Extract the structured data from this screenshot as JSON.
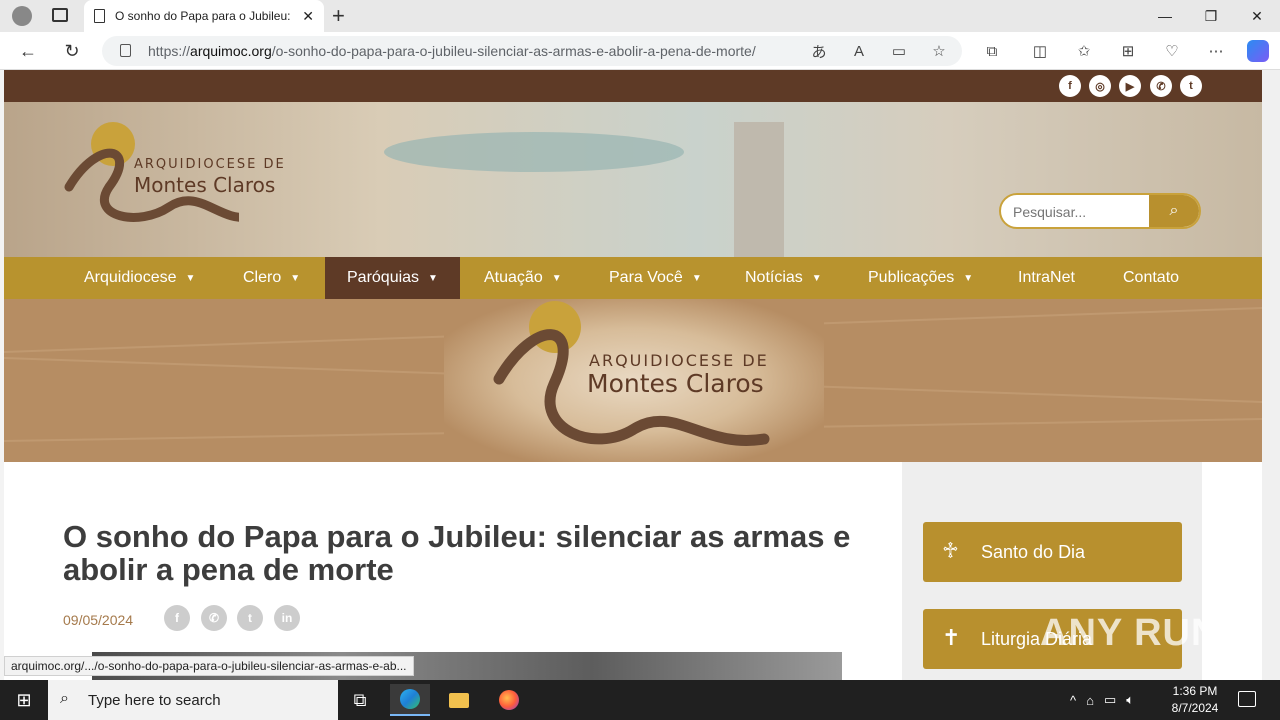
{
  "browser": {
    "tab_title": "O sonho do Papa para o Jubileu:",
    "url_host": "arquimoc.org",
    "url_prefix": "https://",
    "url_path": "/o-sonho-do-papa-para-o-jubileu-silenciar-as-armas-e-abolir-a-pena-de-morte/",
    "status_url": "arquimoc.org/.../o-sonho-do-papa-para-o-jubileu-silenciar-as-armas-e-ab..."
  },
  "site": {
    "logo_line1": "ARQUIDIOCESE DE",
    "logo_line2": "Montes Claros",
    "social": [
      "facebook-icon",
      "instagram-icon",
      "youtube-icon",
      "whatsapp-icon",
      "twitter-icon"
    ],
    "search_placeholder": "Pesquisar...",
    "menu": [
      {
        "label": "Arquidiocese",
        "dropdown": true
      },
      {
        "label": "Clero",
        "dropdown": true
      },
      {
        "label": "Paróquias",
        "dropdown": true,
        "active": true
      },
      {
        "label": "Atuação",
        "dropdown": true
      },
      {
        "label": "Para Você",
        "dropdown": true
      },
      {
        "label": "Notícias",
        "dropdown": true
      },
      {
        "label": "Publicações",
        "dropdown": true
      },
      {
        "label": "IntraNet",
        "dropdown": false
      },
      {
        "label": "Contato",
        "dropdown": false
      }
    ],
    "colors": {
      "brown": "#5e3a26",
      "gold": "#b8932e",
      "banner": "#b68d63"
    }
  },
  "article": {
    "title": "O sonho do Papa para o Jubileu: silenciar as armas e abolir a pena de morte",
    "date": "09/05/2024",
    "share": [
      "facebook-icon",
      "whatsapp-icon",
      "twitter-icon",
      "linkedin-icon"
    ]
  },
  "sidebar": {
    "items": [
      {
        "label": "Santo do Dia",
        "icon": "saint-icon"
      },
      {
        "label": "Liturgia Diária",
        "icon": "bible-icon"
      }
    ]
  },
  "watermark": "ANY RUN",
  "taskbar": {
    "search_placeholder": "Type here to search",
    "time": "1:36 PM",
    "date": "8/7/2024"
  }
}
